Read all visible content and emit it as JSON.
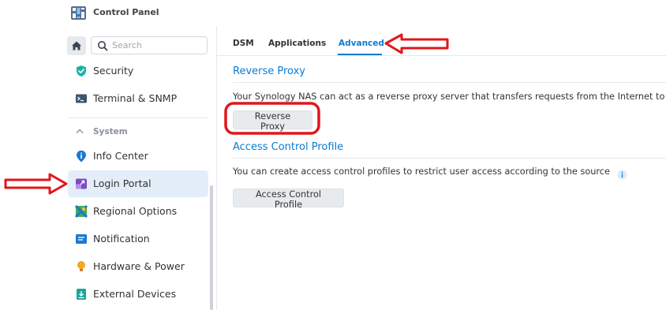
{
  "window": {
    "title": "Control Panel",
    "app_icon": "control-panel-icon"
  },
  "sidebar": {
    "search_placeholder": "Search",
    "items_top": [
      {
        "label": "Security",
        "icon": "shield-icon"
      },
      {
        "label": "Terminal & SNMP",
        "icon": "terminal-icon"
      }
    ],
    "section_label": "System",
    "items_system": [
      {
        "label": "Info Center",
        "icon": "info-icon"
      },
      {
        "label": "Login Portal",
        "icon": "login-portal-icon",
        "active": true
      },
      {
        "label": "Regional Options",
        "icon": "regional-icon"
      },
      {
        "label": "Notification",
        "icon": "notification-icon"
      },
      {
        "label": "Hardware & Power",
        "icon": "lightbulb-icon"
      },
      {
        "label": "External Devices",
        "icon": "external-devices-icon"
      }
    ]
  },
  "tabs": [
    {
      "label": "DSM"
    },
    {
      "label": "Applications"
    },
    {
      "label": "Advanced",
      "active": true
    }
  ],
  "main": {
    "reverse_proxy": {
      "title": "Reverse Proxy",
      "description": "Your Synology NAS can act as a reverse proxy server that transfers requests from the Internet to de",
      "button": "Reverse Proxy"
    },
    "access_control": {
      "title": "Access Control Profile",
      "description": "You can create access control profiles to restrict user access according to the source IP.",
      "button": "Access Control Profile"
    }
  },
  "colors": {
    "accent": "#0a7cd4",
    "active_bg": "#e4eef9",
    "annotation": "#e0161b"
  }
}
